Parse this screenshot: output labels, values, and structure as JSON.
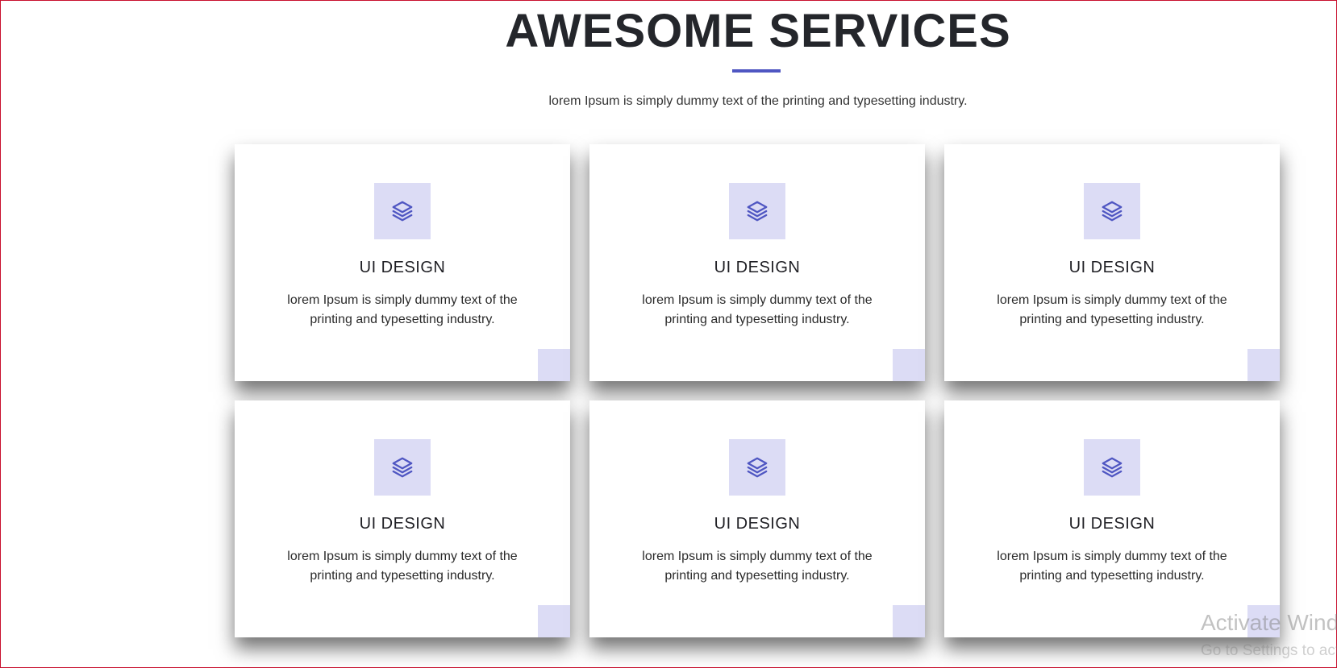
{
  "section": {
    "title": "AWESOME SERVICES",
    "subtitle": "lorem Ipsum is simply dummy text of the printing and typesetting industry.",
    "accent_color": "#4f56c2",
    "icon_bg_color": "#dcdcf5"
  },
  "cards": [
    {
      "icon": "layers-icon",
      "title": "UI DESIGN",
      "text": "lorem Ipsum is simply dummy text of the printing and typesetting industry."
    },
    {
      "icon": "layers-icon",
      "title": "UI DESIGN",
      "text": "lorem Ipsum is simply dummy text of the printing and typesetting industry."
    },
    {
      "icon": "layers-icon",
      "title": "UI DESIGN",
      "text": "lorem Ipsum is simply dummy text of the printing and typesetting industry."
    },
    {
      "icon": "layers-icon",
      "title": "UI DESIGN",
      "text": "lorem Ipsum is simply dummy text of the printing and typesetting industry."
    },
    {
      "icon": "layers-icon",
      "title": "UI DESIGN",
      "text": "lorem Ipsum is simply dummy text of the printing and typesetting industry."
    },
    {
      "icon": "layers-icon",
      "title": "UI DESIGN",
      "text": "lorem Ipsum is simply dummy text of the printing and typesetting industry."
    }
  ],
  "watermark": {
    "line1": "Activate Windows",
    "line2": "Go to Settings to activate Windows."
  }
}
